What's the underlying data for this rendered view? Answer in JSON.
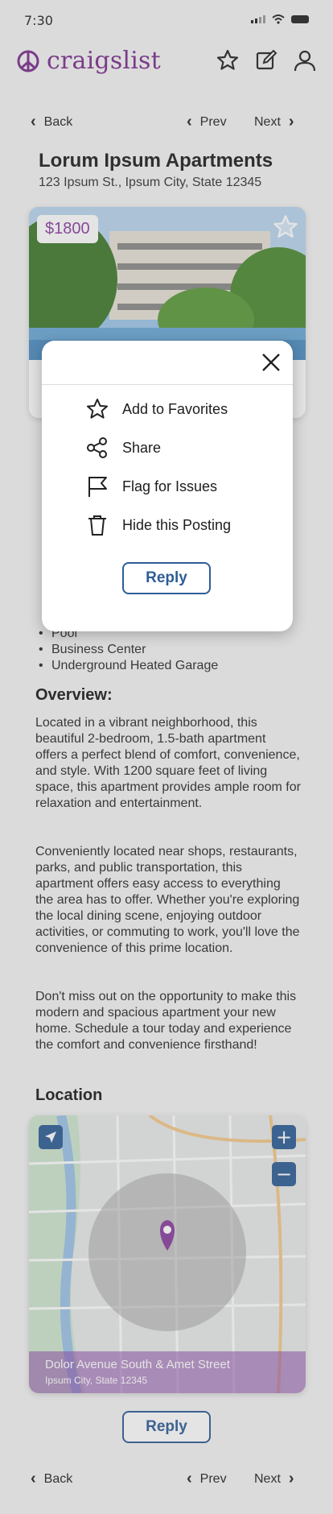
{
  "status_bar": {
    "time": "7:30"
  },
  "header": {
    "logo_text": "craigslist"
  },
  "nav": {
    "back": "Back",
    "prev": "Prev",
    "next": "Next"
  },
  "listing": {
    "title": "Lorum Ipsum Apartments",
    "address": "123 Ipsum St., Ipsum City, State 12345",
    "price": "$1800"
  },
  "amenities": [
    "Pool",
    "Business Center",
    "Underground Heated Garage"
  ],
  "overview": {
    "heading": "Overview:",
    "paragraphs": [
      "Located in a vibrant neighborhood, this beautiful 2-bedroom, 1.5-bath apartment offers a perfect blend of comfort, convenience, and style. With 1200 square feet of living space, this apartment provides ample room for relaxation and entertainment.",
      "Conveniently located near shops, restaurants, parks, and public transportation, this apartment offers easy access to everything the area has to offer. Whether you're exploring the local dining scene, enjoying outdoor activities, or commuting to work, you'll love the convenience of this prime location.",
      "Don't miss out on the opportunity to make this modern and spacious apartment your new home. Schedule a tour today and experience the comfort and convenience firsthand!"
    ]
  },
  "location": {
    "heading": "Location",
    "street": "Dolor Avenue South & Amet Street",
    "city": "Ipsum City, State 12345"
  },
  "reply_label": "Reply",
  "popup": {
    "items": [
      "Add to Favorites",
      "Share",
      "Flag for Issues",
      "Hide this Posting"
    ],
    "reply_label": "Reply"
  }
}
